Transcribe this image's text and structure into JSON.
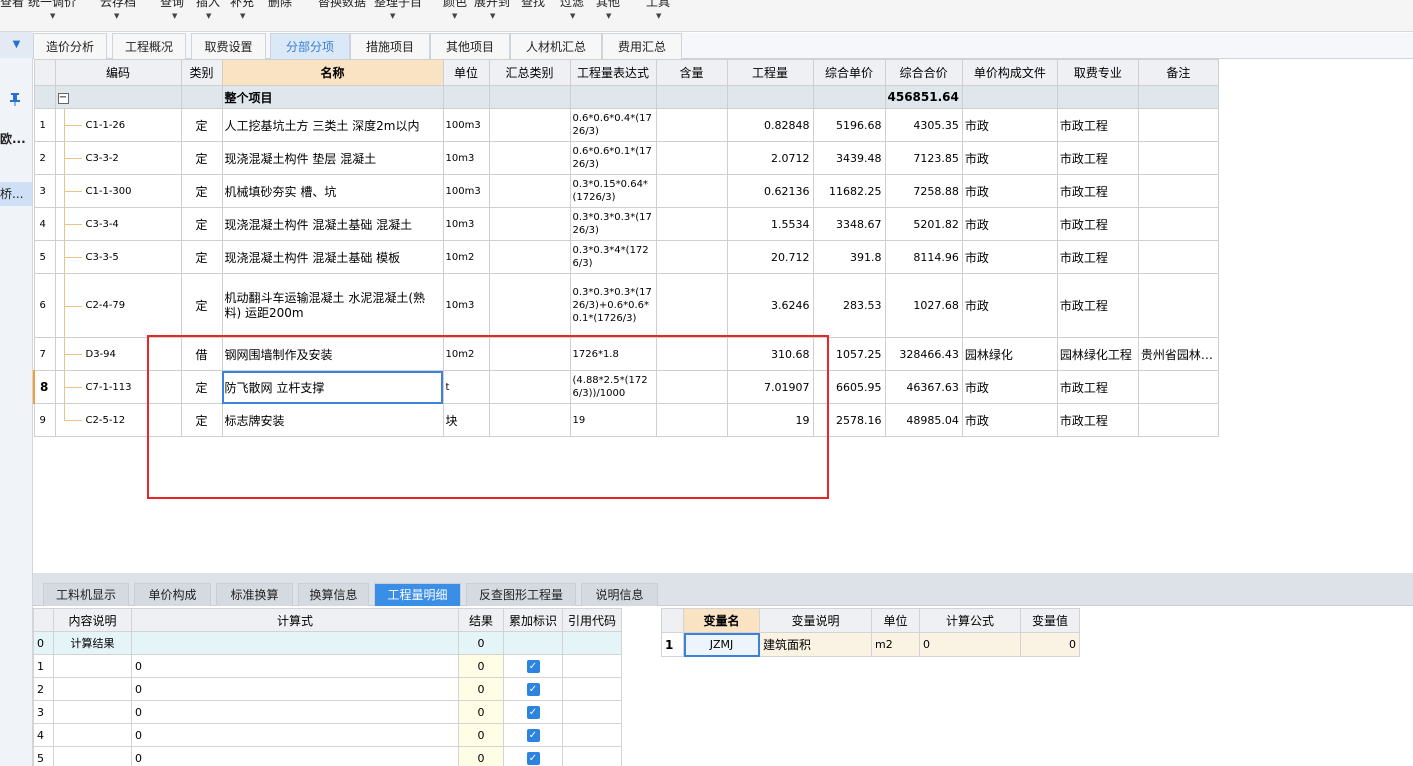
{
  "toolbar": {
    "items": [
      "查看",
      "统一调价",
      "云存档",
      "查询",
      "插入",
      "补充",
      "删除",
      "替换数据",
      "整理子目",
      "颜色",
      "展开到",
      "查找",
      "过滤",
      "其他",
      "工具"
    ]
  },
  "sidebar": {
    "item1": "欧...",
    "item2": "桥..."
  },
  "tabs": [
    "造价分析",
    "工程概况",
    "取费设置",
    "分部分项",
    "措施项目",
    "其他项目",
    "人材机汇总",
    "费用汇总"
  ],
  "grid": {
    "headers": [
      "编码",
      "类别",
      "名称",
      "单位",
      "汇总类别",
      "工程量表达式",
      "含量",
      "工程量",
      "综合单价",
      "综合合价",
      "单价构成文件",
      "取费专业",
      "备注"
    ],
    "group": {
      "name": "整个项目",
      "total": "456851.64"
    },
    "rows": [
      {
        "idx": "1",
        "code": "C1-1-26",
        "type": "定",
        "name": "人工挖基坑土方 三类土 深度2m以内",
        "unit": "100m3",
        "expr": "0.6*0.6*0.4*(1726/3)",
        "qty": "0.82848",
        "price": "5196.68",
        "total": "4305.35",
        "file": "市政",
        "major": "市政工程",
        "note": ""
      },
      {
        "idx": "2",
        "code": "C3-3-2",
        "type": "定",
        "name": "现浇混凝土构件 垫层 混凝土",
        "unit": "10m3",
        "expr": "0.6*0.6*0.1*(1726/3)",
        "qty": "2.0712",
        "price": "3439.48",
        "total": "7123.85",
        "file": "市政",
        "major": "市政工程",
        "note": ""
      },
      {
        "idx": "3",
        "code": "C1-1-300",
        "type": "定",
        "name": "机械填砂夯实 槽、坑",
        "unit": "100m3",
        "expr": "0.3*0.15*0.64*(1726/3)",
        "qty": "0.62136",
        "price": "11682.25",
        "total": "7258.88",
        "file": "市政",
        "major": "市政工程",
        "note": ""
      },
      {
        "idx": "4",
        "code": "C3-3-4",
        "type": "定",
        "name": "现浇混凝土构件 混凝土基础 混凝土",
        "unit": "10m3",
        "expr": "0.3*0.3*0.3*(1726/3)",
        "qty": "1.5534",
        "price": "3348.67",
        "total": "5201.82",
        "file": "市政",
        "major": "市政工程",
        "note": ""
      },
      {
        "idx": "5",
        "code": "C3-3-5",
        "type": "定",
        "name": "现浇混凝土构件 混凝土基础 模板",
        "unit": "10m2",
        "expr": "0.3*0.3*4*(1726/3)",
        "qty": "20.712",
        "price": "391.8",
        "total": "8114.96",
        "file": "市政",
        "major": "市政工程",
        "note": ""
      },
      {
        "idx": "6",
        "code": "C2-4-79",
        "type": "定",
        "name": "机动翻斗车运输混凝土 水泥混凝土(熟料) 运距200m",
        "unit": "10m3",
        "expr": "0.3*0.3*0.3*(1726/3)+0.6*0.6*0.1*(1726/3)",
        "qty": "3.6246",
        "price": "283.53",
        "total": "1027.68",
        "file": "市政",
        "major": "市政工程",
        "note": ""
      },
      {
        "idx": "7",
        "code": "D3-94",
        "type": "借",
        "name": "钢网围墙制作及安装",
        "unit": "10m2",
        "expr": "1726*1.8",
        "qty": "310.68",
        "price": "1057.25",
        "total": "328466.43",
        "file": "园林绿化",
        "major": "园林绿化工程",
        "note": "贵州省园林…"
      },
      {
        "idx": "8",
        "code": "C7-1-113",
        "type": "定",
        "name": "防飞散网 立杆支撑",
        "unit": "t",
        "expr": "(4.88*2.5*(1726/3))/1000",
        "qty": "7.01907",
        "price": "6605.95",
        "total": "46367.63",
        "file": "市政",
        "major": "市政工程",
        "note": ""
      },
      {
        "idx": "9",
        "code": "C2-5-12",
        "type": "定",
        "name": "标志牌安装",
        "unit": "块",
        "expr": "19",
        "qty": "19",
        "price": "2578.16",
        "total": "48985.04",
        "file": "市政",
        "major": "市政工程",
        "note": ""
      }
    ]
  },
  "bottom_tabs": [
    "工料机显示",
    "单价构成",
    "标准换算",
    "换算信息",
    "工程量明细",
    "反查图形工程量",
    "说明信息"
  ],
  "detail": {
    "headers": [
      "内容说明",
      "计算式",
      "结果",
      "累加标识",
      "引用代码"
    ],
    "rows": [
      {
        "idx": "0",
        "desc": "计算结果",
        "formula": "",
        "result": "0",
        "check": false
      },
      {
        "idx": "1",
        "desc": "",
        "formula": "0",
        "result": "0",
        "check": true
      },
      {
        "idx": "2",
        "desc": "",
        "formula": "0",
        "result": "0",
        "check": true
      },
      {
        "idx": "3",
        "desc": "",
        "formula": "0",
        "result": "0",
        "check": true
      },
      {
        "idx": "4",
        "desc": "",
        "formula": "0",
        "result": "0",
        "check": true
      },
      {
        "idx": "5",
        "desc": "",
        "formula": "0",
        "result": "0",
        "check": true
      }
    ]
  },
  "variables": {
    "headers": [
      "变量名",
      "变量说明",
      "单位",
      "计算公式",
      "变量值"
    ],
    "rows": [
      {
        "idx": "1",
        "name": "JZMJ",
        "desc": "建筑面积",
        "unit": "m2",
        "formula": "0",
        "value": "0"
      }
    ]
  },
  "icons": {
    "checkbox": "✓",
    "pin": "pin-icon",
    "dropdown": "▼",
    "collapse": "−"
  }
}
